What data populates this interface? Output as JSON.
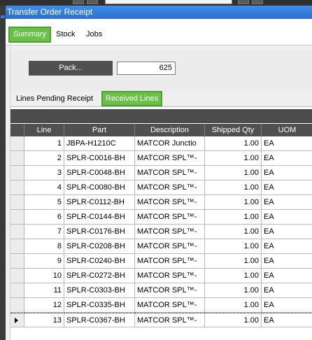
{
  "window": {
    "title": "Transfer Order Receipt"
  },
  "page_tabs": [
    {
      "label": "Summary",
      "active": true
    },
    {
      "label": "Stock",
      "active": false
    },
    {
      "label": "Jobs",
      "active": false
    }
  ],
  "pack": {
    "button_label": "Pack...",
    "value": "625"
  },
  "sub_tabs": [
    {
      "label": "Lines Pending Receipt",
      "active": false
    },
    {
      "label": "Received Lines",
      "active": true
    }
  ],
  "grid": {
    "columns": [
      "Line",
      "Part",
      "Description",
      "Shipped Qty",
      "UOM"
    ],
    "rows": [
      {
        "line": "1",
        "part": "JBPA-H1210C",
        "description": "MATCOR Junctio",
        "qty": "1.00",
        "uom": "EA"
      },
      {
        "line": "2",
        "part": "SPLR-C0016-BH",
        "description": "MATCOR SPL™-",
        "qty": "1.00",
        "uom": "EA"
      },
      {
        "line": "3",
        "part": "SPLR-C0048-BH",
        "description": "MATCOR SPL™-",
        "qty": "1.00",
        "uom": "EA"
      },
      {
        "line": "4",
        "part": "SPLR-C0080-BH",
        "description": "MATCOR SPL™-",
        "qty": "1.00",
        "uom": "EA"
      },
      {
        "line": "5",
        "part": "SPLR-C0112-BH",
        "description": "MATCOR SPL™-",
        "qty": "1.00",
        "uom": "EA"
      },
      {
        "line": "6",
        "part": "SPLR-C0144-BH",
        "description": "MATCOR SPL™-",
        "qty": "1.00",
        "uom": "EA"
      },
      {
        "line": "7",
        "part": "SPLR-C0176-BH",
        "description": "MATCOR SPL™-",
        "qty": "1.00",
        "uom": "EA"
      },
      {
        "line": "8",
        "part": "SPLR-C0208-BH",
        "description": "MATCOR SPL™-",
        "qty": "1.00",
        "uom": "EA"
      },
      {
        "line": "9",
        "part": "SPLR-C0240-BH",
        "description": "MATCOR SPL™-",
        "qty": "1.00",
        "uom": "EA"
      },
      {
        "line": "10",
        "part": "SPLR-C0272-BH",
        "description": "MATCOR SPL™-",
        "qty": "1.00",
        "uom": "EA"
      },
      {
        "line": "11",
        "part": "SPLR-C0303-BH",
        "description": "MATCOR SPL™-",
        "qty": "1.00",
        "uom": "EA"
      },
      {
        "line": "12",
        "part": "SPLR-C0335-BH",
        "description": "MATCOR SPL™-",
        "qty": "1.00",
        "uom": "EA"
      },
      {
        "line": "13",
        "part": "SPLR-C0367-BH",
        "description": "MATCOR SPL™-",
        "qty": "1.00",
        "uom": "EA"
      }
    ],
    "current_row": 13
  },
  "colors": {
    "titlebar": "#2f7ddb",
    "active_tab": "#6cc04a",
    "grid_header": "#505050"
  }
}
